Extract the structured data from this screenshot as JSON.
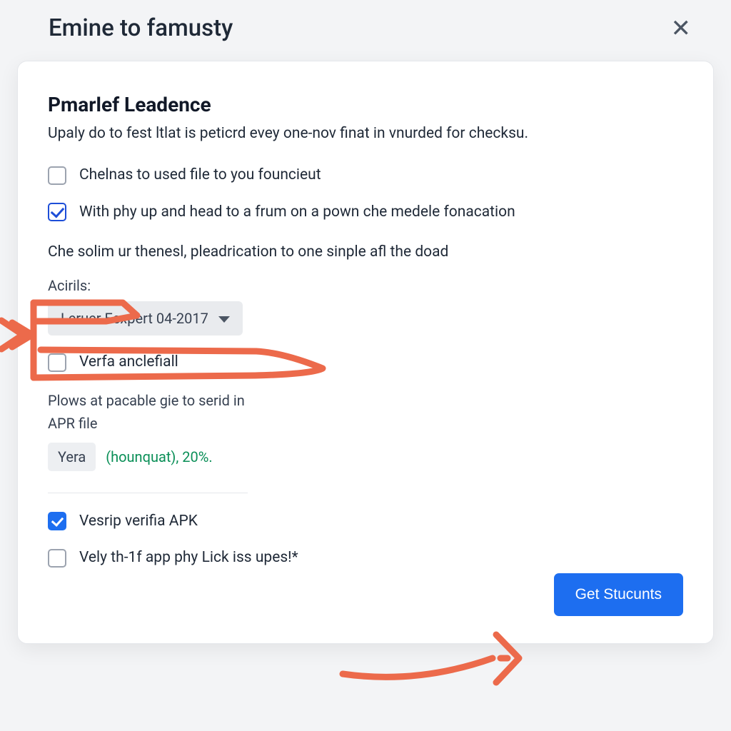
{
  "dialog": {
    "title": "Emine to famusty",
    "close_label": "✕"
  },
  "main": {
    "section_title": "Pmarlef Leadence",
    "section_sub": "Upaly do to fest ltlat is peticrd evey one-nov finat in vnurded for checksu.",
    "option1": "Chelnas to used file to you founcieut",
    "option2": "With phy up and head to a frum on a pown che medele fonacation",
    "helper": "Che solim ur thenesl, pleadrication to one sinple afl the doad",
    "field_label": "Acirils:",
    "select_value": "Leruer Eexpert 04-2017",
    "option3": "Verfa anclefiall",
    "plows_line1": "Plows at pacable gie to serid in",
    "plows_line2": "APR file",
    "yera_pill": "Yera",
    "yera_green": "(hounquat),  20%.",
    "option4": "Vesrip verifia APK",
    "option5": "Vely th-1f app phy Lick iss upes!*",
    "primary_button": "Get Stucunts"
  }
}
